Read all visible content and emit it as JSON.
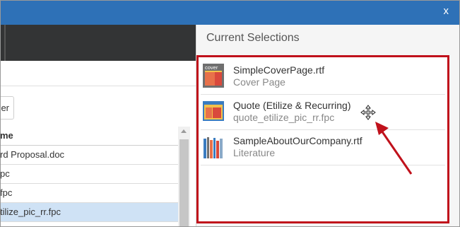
{
  "window": {
    "close_label": "x"
  },
  "left": {
    "button_label": "er",
    "column_header": "me",
    "files": [
      {
        "label": "rd Proposal.doc",
        "selected": false
      },
      {
        "label": "pc",
        "selected": false
      },
      {
        "label": "fpc",
        "selected": false
      },
      {
        "label": "tilize_pic_rr.fpc",
        "selected": true
      }
    ]
  },
  "right": {
    "title": "Current Selections",
    "selections": [
      {
        "name": "SimpleCoverPage.rtf",
        "category": "Cover Page",
        "icon": "cover-page-icon",
        "thumb_text": "cover"
      },
      {
        "name": "Quote (Etilize & Recurring)",
        "category": "quote_etilize_pic_rr.fpc",
        "icon": "quote-icon"
      },
      {
        "name": "SampleAboutOurCompany.rtf",
        "category": "Literature",
        "icon": "books-icon"
      }
    ]
  },
  "colors": {
    "titlebar": "#2e71b7",
    "highlight_border": "#c0111b",
    "selected_row": "#cfe2f5",
    "annotation_arrow": "#c0111b"
  }
}
